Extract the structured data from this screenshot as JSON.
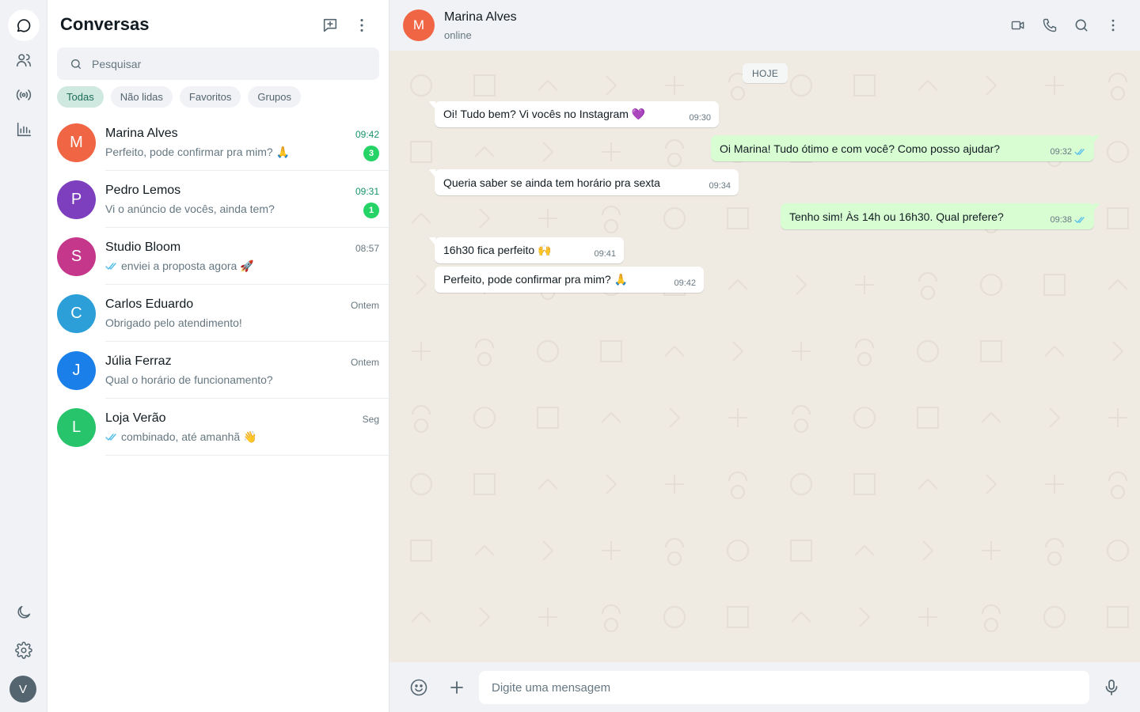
{
  "sidebar": {
    "title": "Conversas",
    "search_placeholder": "Pesquisar",
    "filters": [
      "Todas",
      "Não lidas",
      "Favoritos",
      "Grupos"
    ],
    "chats": [
      {
        "initial": "M",
        "name": "Marina Alves",
        "preview": "Perfeito, pode confirmar pra mim? 🙏",
        "time": "09:42",
        "unread": "3",
        "color": "#f06543",
        "ticks": false
      },
      {
        "initial": "P",
        "name": "Pedro Lemos",
        "preview": "Vi o anúncio de vocês, ainda tem?",
        "time": "09:31",
        "unread": "1",
        "color": "#7e3fbf",
        "ticks": false
      },
      {
        "initial": "S",
        "name": "Studio Bloom",
        "preview": "enviei a proposta agora 🚀",
        "time": "08:57",
        "unread": "",
        "color": "#c4378a",
        "ticks": true
      },
      {
        "initial": "C",
        "name": "Carlos Eduardo",
        "preview": "Obrigado pelo atendimento!",
        "time": "Ontem",
        "unread": "",
        "color": "#2c9fd8",
        "ticks": false
      },
      {
        "initial": "J",
        "name": "Júlia Ferraz",
        "preview": "Qual o horário de funcionamento?",
        "time": "Ontem",
        "unread": "",
        "color": "#1a7fe8",
        "ticks": false
      },
      {
        "initial": "L",
        "name": "Loja Verão",
        "preview": "combinado, até amanhã 👋",
        "time": "Seg",
        "unread": "",
        "color": "#27c46b",
        "ticks": true
      }
    ]
  },
  "rail": {
    "user_initial": "V"
  },
  "conversation": {
    "contact_initial": "M",
    "contact_name": "Marina Alves",
    "contact_status": "online",
    "day_label": "HOJE",
    "messages": [
      {
        "dir": "in",
        "text": "Oi! Tudo bem? Vi vocês no Instagram 💜",
        "time": "09:30"
      },
      {
        "dir": "out",
        "text": "Oi Marina! Tudo ótimo e com você? Como posso ajudar?",
        "time": "09:32"
      },
      {
        "dir": "in",
        "text": "Queria saber se ainda tem horário pra sexta",
        "time": "09:34"
      },
      {
        "dir": "out",
        "text": "Tenho sim! Às 14h ou 16h30. Qual prefere?",
        "time": "09:38"
      },
      {
        "dir": "in",
        "text": "16h30 fica perfeito 🙌",
        "time": "09:41"
      },
      {
        "dir": "in",
        "text": "Perfeito, pode confirmar pra mim? 🙏",
        "time": "09:42"
      }
    ],
    "composer_placeholder": "Digite uma mensagem"
  },
  "colors": {
    "incoming_bubble": "#ffffff",
    "outgoing_bubble": "#d9fdd3",
    "unread_badge": "#25d366",
    "read_ticks": "#53bdeb"
  }
}
